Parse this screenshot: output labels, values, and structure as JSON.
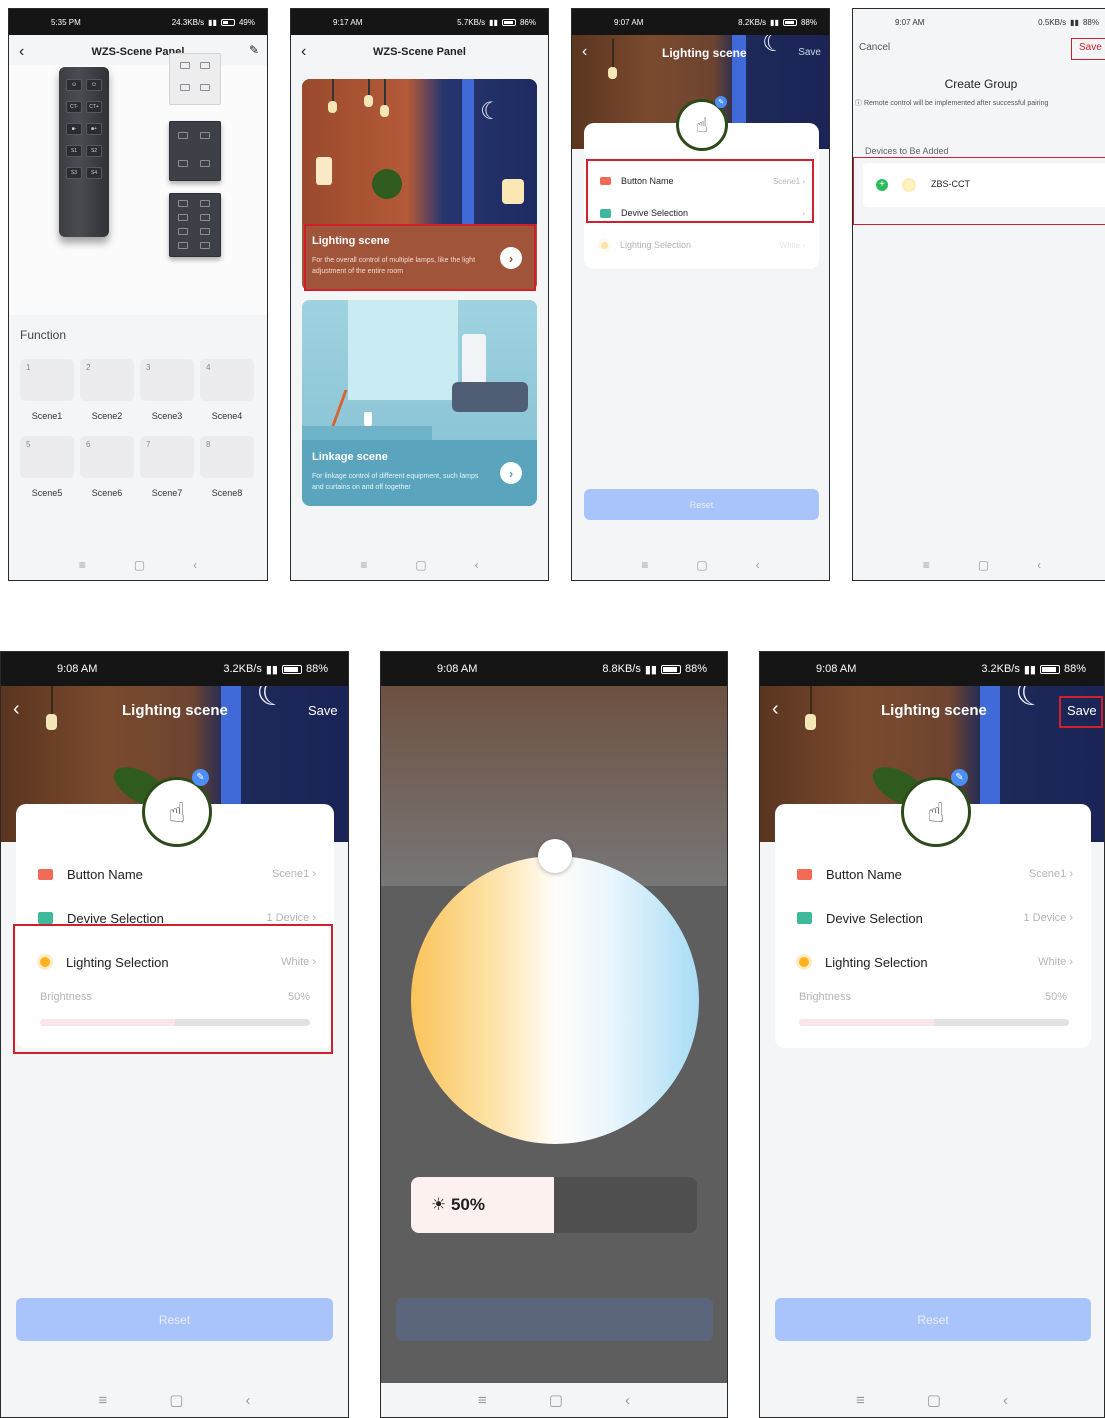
{
  "colors": {
    "accent_red": "#d0202e",
    "reset_blue": "#a9c4fa",
    "highlight_red": "#e53935",
    "icon_red": "#f06a55",
    "icon_green": "#3fb99b",
    "sun": "#ffb21e"
  },
  "nav": {
    "menu": "≡",
    "home": "▢",
    "back": "‹"
  },
  "p1": {
    "status": {
      "time": "5:35 PM",
      "net": "24.3KB/s",
      "batt": "49%"
    },
    "title": "WZS-Scene Panel",
    "section": "Function",
    "remote_keys": [
      "⊙",
      "⏻",
      "CT-",
      "CT+",
      "■-",
      "■+",
      "S1",
      "S2",
      "S3",
      "S4"
    ],
    "items": [
      {
        "n": "1",
        "label": "Scene1"
      },
      {
        "n": "2",
        "label": "Scene2"
      },
      {
        "n": "3",
        "label": "Scene3"
      },
      {
        "n": "4",
        "label": "Scene4"
      },
      {
        "n": "5",
        "label": "Scene5"
      },
      {
        "n": "6",
        "label": "Scene6"
      },
      {
        "n": "7",
        "label": "Scene7"
      },
      {
        "n": "8",
        "label": "Scene8"
      }
    ]
  },
  "p2": {
    "status": {
      "time": "9:17 AM",
      "net": "5.7KB/s",
      "batt": "86%"
    },
    "title": "WZS-Scene Panel",
    "card1": {
      "title": "Lighting scene",
      "desc": "For the overall control of multiple lamps, like the light adjustment of the entire room"
    },
    "card2": {
      "title": "Linkage scene",
      "desc": "For linkage control of different equipment, such lamps and curtains on and off together"
    }
  },
  "p3": {
    "status": {
      "time": "9:07 AM",
      "net": "8.2KB/s",
      "batt": "88%"
    },
    "title": "Lighting scene",
    "save": "Save",
    "rows": [
      {
        "label": "Button Name",
        "value": "Scene1 ›"
      },
      {
        "label": "Devive Selection",
        "value": "›"
      },
      {
        "label": "Lighting Selection",
        "value": "White ›"
      }
    ],
    "reset": "Reset"
  },
  "p4": {
    "status": {
      "time": "9:07 AM",
      "net": "0.5KB/s",
      "batt": "88%"
    },
    "cancel": "Cancel",
    "save": "Save",
    "title": "Create Group",
    "note": "Remote control will be implemented after successful pairing",
    "section": "Devices to Be Added",
    "device": "ZBS-CCT"
  },
  "p5": {
    "status": {
      "time": "9:08 AM",
      "net": "3.2KB/s",
      "batt": "88%"
    },
    "title": "Lighting scene",
    "save": "Save",
    "rows": [
      {
        "label": "Button Name",
        "value": "Scene1 ›"
      },
      {
        "label": "Devive Selection",
        "value": "1 Device ›"
      },
      {
        "label": "Lighting Selection",
        "value": "White ›"
      }
    ],
    "brightness_label": "Brightness",
    "brightness_value": "50%",
    "brightness_level": 0.5,
    "reset": "Reset"
  },
  "p6": {
    "status": {
      "time": "9:08 AM",
      "net": "8.8KB/s",
      "batt": "88%"
    },
    "brightness": "50%",
    "brightness_level": 0.5
  },
  "p7": {
    "status": {
      "time": "9:08 AM",
      "net": "3.2KB/s",
      "batt": "88%"
    },
    "title": "Lighting scene",
    "save": "Save",
    "rows": [
      {
        "label": "Button Name",
        "value": "Scene1 ›"
      },
      {
        "label": "Devive Selection",
        "value": "1 Device ›"
      },
      {
        "label": "Lighting Selection",
        "value": "White ›"
      }
    ],
    "brightness_label": "Brightness",
    "brightness_value": "50%",
    "brightness_level": 0.5,
    "reset": "Reset"
  }
}
